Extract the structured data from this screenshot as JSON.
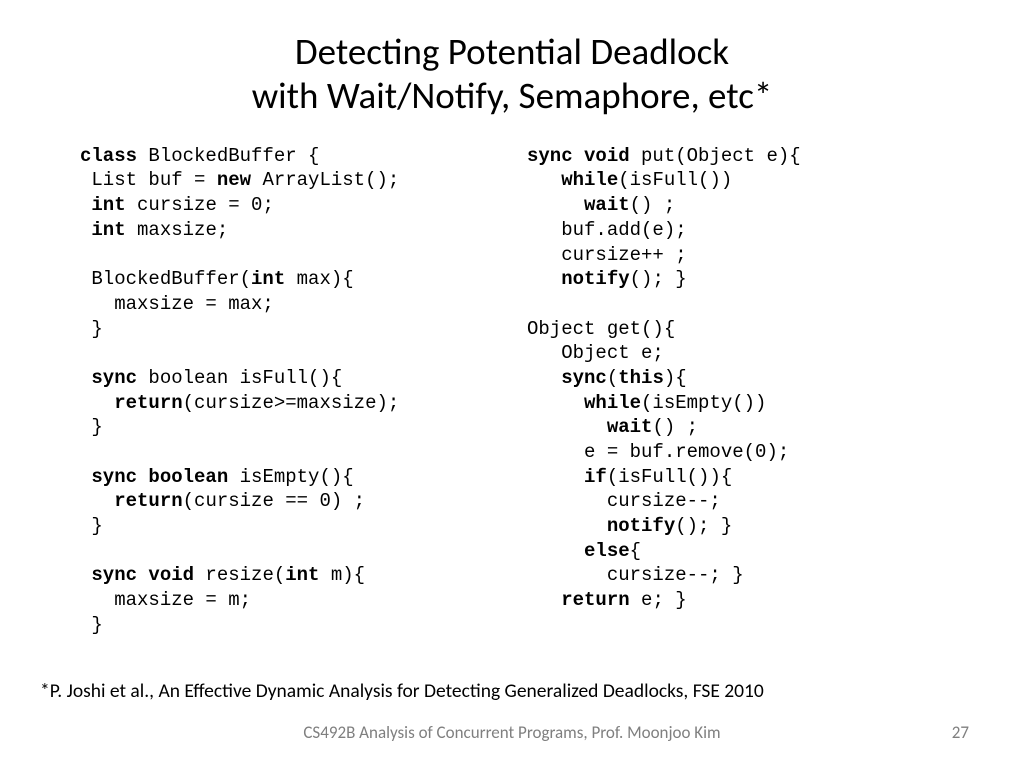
{
  "title_line1": "Detecting Potential Deadlock",
  "title_line2": "with Wait/Notify, Semaphore, etc*",
  "left": {
    "l01a": "class",
    "l01b": " BlockedBuffer {",
    "l02a": " List buf = ",
    "l02b": "new",
    "l02c": " ArrayList();",
    "l03a": " ",
    "l03b": "int",
    "l03c": " cursize = 0;",
    "l04a": " ",
    "l04b": "int",
    "l04c": " maxsize;",
    "l05": "",
    "l06a": " BlockedBuffer(",
    "l06b": "int",
    "l06c": " max){",
    "l07": "   maxsize = max;",
    "l08": " }",
    "l09": "",
    "l10a": " ",
    "l10b": "sync",
    "l10c": " boolean isFull(){",
    "l11a": "   ",
    "l11b": "return",
    "l11c": "(cursize>=maxsize);",
    "l12": " }",
    "l13": "",
    "l14a": " ",
    "l14b": "sync boolean",
    "l14c": " isEmpty(){",
    "l15a": "   ",
    "l15b": "return",
    "l15c": "(cursize == 0) ;",
    "l16": " }",
    "l17": "",
    "l18a": " ",
    "l18b": "sync void",
    "l18c": " resize(",
    "l18d": "int",
    "l18e": " m){",
    "l19": "   maxsize = m;",
    "l20": " }"
  },
  "right": {
    "r01a": "sync void",
    "r01b": " put(Object e){",
    "r02a": "   ",
    "r02b": "while",
    "r02c": "(isFull())",
    "r03a": "     ",
    "r03b": "wait",
    "r03c": "() ;",
    "r04": "   buf.add(e);",
    "r05": "   cursize++ ;",
    "r06a": "   ",
    "r06b": "notify",
    "r06c": "(); }",
    "r07": "",
    "r08": "Object get(){",
    "r09": "   Object e;",
    "r10a": "   ",
    "r10b": "sync",
    "r10c": "(",
    "r10d": "this",
    "r10e": "){",
    "r11a": "     ",
    "r11b": "while",
    "r11c": "(isEmpty())",
    "r12a": "       ",
    "r12b": "wait",
    "r12c": "() ;",
    "r13": "     e = buf.remove(0);",
    "r14a": "     ",
    "r14b": "if",
    "r14c": "(isFull()){",
    "r15": "       cursize--;",
    "r16a": "       ",
    "r16b": "notify",
    "r16c": "(); }",
    "r17a": "     ",
    "r17b": "else",
    "r17c": "{",
    "r18": "       cursize--; }",
    "r19a": "   ",
    "r19b": "return",
    "r19c": " e; }"
  },
  "citation": "*P. Joshi et al., An Effective Dynamic Analysis for Detecting Generalized Deadlocks, FSE 2010",
  "footer": "CS492B Analysis of Concurrent Programs, Prof. Moonjoo Kim",
  "page": "27"
}
